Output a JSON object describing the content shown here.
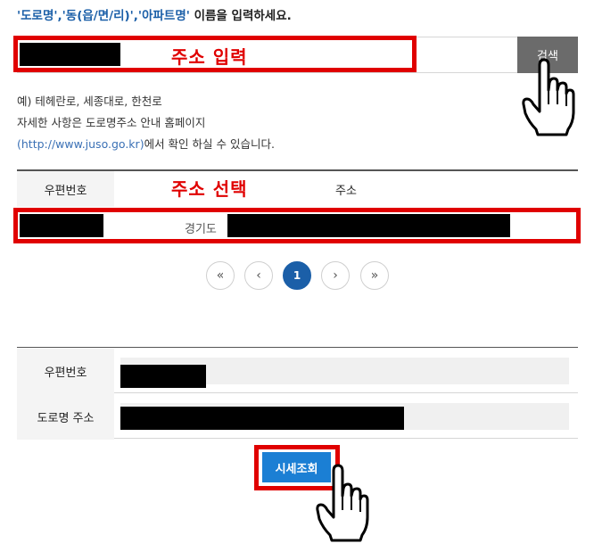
{
  "instruction": {
    "keywords": "'도로명','동(읍/면/리)','아파트명'",
    "rest": " 이름을 입력하세요."
  },
  "search": {
    "button_label": "검색",
    "annotation": "주소 입력"
  },
  "help": {
    "line1": "예) 테헤란로, 세종대로, 한천로",
    "line2": "자세한 사항은 도로명주소 안내 홈페이지",
    "link": "(http://www.juso.go.kr)",
    "line3_rest": "에서 확인 하실 수 있습니다."
  },
  "results": {
    "annotation": "주소 선택",
    "columns": [
      "우편번호",
      "주소"
    ],
    "rows": [
      {
        "address_prefix": "경기도"
      }
    ]
  },
  "pagination": {
    "first": "«",
    "prev": "‹",
    "current": "1",
    "next": "›",
    "last": "»"
  },
  "form": {
    "zip_label": "우편번호",
    "road_label": "도로명 주소"
  },
  "detail_button": {
    "label": "시세조회"
  },
  "colors": {
    "accent_blue": "#1b5fa8",
    "button_blue": "#1b7fd4",
    "annotation_red": "#e00000"
  },
  "icons": [
    "pointing-hand-icon",
    "pointing-hand-icon"
  ]
}
